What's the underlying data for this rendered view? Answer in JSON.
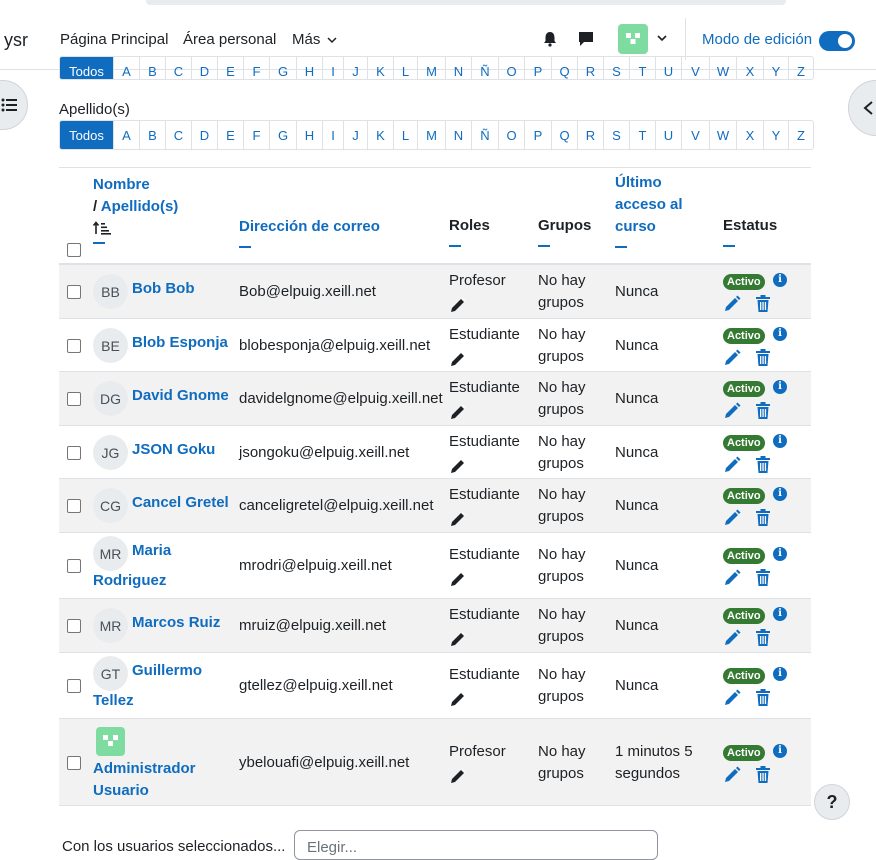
{
  "navbar": {
    "brand": "ysr",
    "links": [
      "Página Principal",
      "Área personal",
      "Más"
    ],
    "edit_mode_label": "Modo de edición",
    "edit_mode_on": true
  },
  "filters": {
    "top_letters": [
      "Todos",
      "A",
      "B",
      "C",
      "D",
      "E",
      "F",
      "G",
      "H",
      "I",
      "J",
      "K",
      "L",
      "M",
      "N",
      "Ñ",
      "O",
      "P",
      "Q",
      "R",
      "S",
      "T",
      "U",
      "V",
      "W",
      "X",
      "Y",
      "Z"
    ],
    "surname_label": "Apellido(s)",
    "letters": [
      "Todos",
      "A",
      "B",
      "C",
      "D",
      "E",
      "F",
      "G",
      "H",
      "I",
      "J",
      "K",
      "L",
      "M",
      "N",
      "Ñ",
      "O",
      "P",
      "Q",
      "R",
      "S",
      "T",
      "U",
      "V",
      "W",
      "X",
      "Y",
      "Z"
    ],
    "active": "Todos"
  },
  "table": {
    "headers": {
      "name": "Nombre",
      "sep": "/",
      "surname": "Apellido(s)",
      "email": "Dirección de correo",
      "roles": "Roles",
      "groups": "Grupos",
      "last_access_1": "Último",
      "last_access_2": "acceso al",
      "last_access_3": "curso",
      "status": "Estatus"
    },
    "rows": [
      {
        "initials": "BB",
        "name": "Bob Bob",
        "email": "Bob@elpuig.xeill.net",
        "role": "Profesor",
        "groups_1": "No hay",
        "groups_2": "grupos",
        "access": "Nunca",
        "status": "Activo"
      },
      {
        "initials": "BE",
        "name": "Blob Esponja",
        "email": "blobesponja@elpuig.xeill.net",
        "role": "Estudiante",
        "groups_1": "No hay",
        "groups_2": "grupos",
        "access": "Nunca",
        "status": "Activo"
      },
      {
        "initials": "DG",
        "name": "David Gnome",
        "email": "davidelgnome@elpuig.xeill.net",
        "role": "Estudiante",
        "groups_1": "No hay",
        "groups_2": "grupos",
        "access": "Nunca",
        "status": "Activo"
      },
      {
        "initials": "JG",
        "name": "JSON Goku",
        "email": "jsongoku@elpuig.xeill.net",
        "role": "Estudiante",
        "groups_1": "No hay",
        "groups_2": "grupos",
        "access": "Nunca",
        "status": "Activo"
      },
      {
        "initials": "CG",
        "name": "Cancel Gretel",
        "email": "canceligretel@elpuig.xeill.net",
        "role": "Estudiante",
        "groups_1": "No hay",
        "groups_2": "grupos",
        "access": "Nunca",
        "status": "Activo"
      },
      {
        "initials": "MR",
        "name_1": "Maria",
        "name_2": "Rodriguez",
        "email": "mrodri@elpuig.xeill.net",
        "role": "Estudiante",
        "groups_1": "No hay",
        "groups_2": "grupos",
        "access": "Nunca",
        "status": "Activo"
      },
      {
        "initials": "MR",
        "name": "Marcos Ruiz",
        "email": "mruiz@elpuig.xeill.net",
        "role": "Estudiante",
        "groups_1": "No hay",
        "groups_2": "grupos",
        "access": "Nunca",
        "status": "Activo"
      },
      {
        "initials": "GT",
        "name_1": "Guillermo",
        "name_2": "Tellez",
        "email": "gtellez@elpuig.xeill.net",
        "role": "Estudiante",
        "groups_1": "No hay",
        "groups_2": "grupos",
        "access": "Nunca",
        "status": "Activo"
      },
      {
        "name_1": "Administrador",
        "name_2": "Usuario",
        "email": "ybelouafi@elpuig.xeill.net",
        "role": "Profesor",
        "groups_1": "No hay",
        "groups_2": "grupos",
        "access_1": "1 minutos 5",
        "access_2": "segundos",
        "status": "Activo"
      }
    ]
  },
  "bulk": {
    "label": "Con los usuarios seleccionados...",
    "placeholder": "Elegir..."
  },
  "help_label": "?",
  "icons": {
    "notifications": "bell-icon",
    "messages": "chat-icon",
    "sort": "sort-ascending-icon",
    "role_edit": "pencil-icon",
    "status_info": "info-icon",
    "edit": "edit-icon",
    "delete": "trash-icon"
  },
  "colors": {
    "accent": "#0f6cbf",
    "active_badge": "#357a32"
  }
}
